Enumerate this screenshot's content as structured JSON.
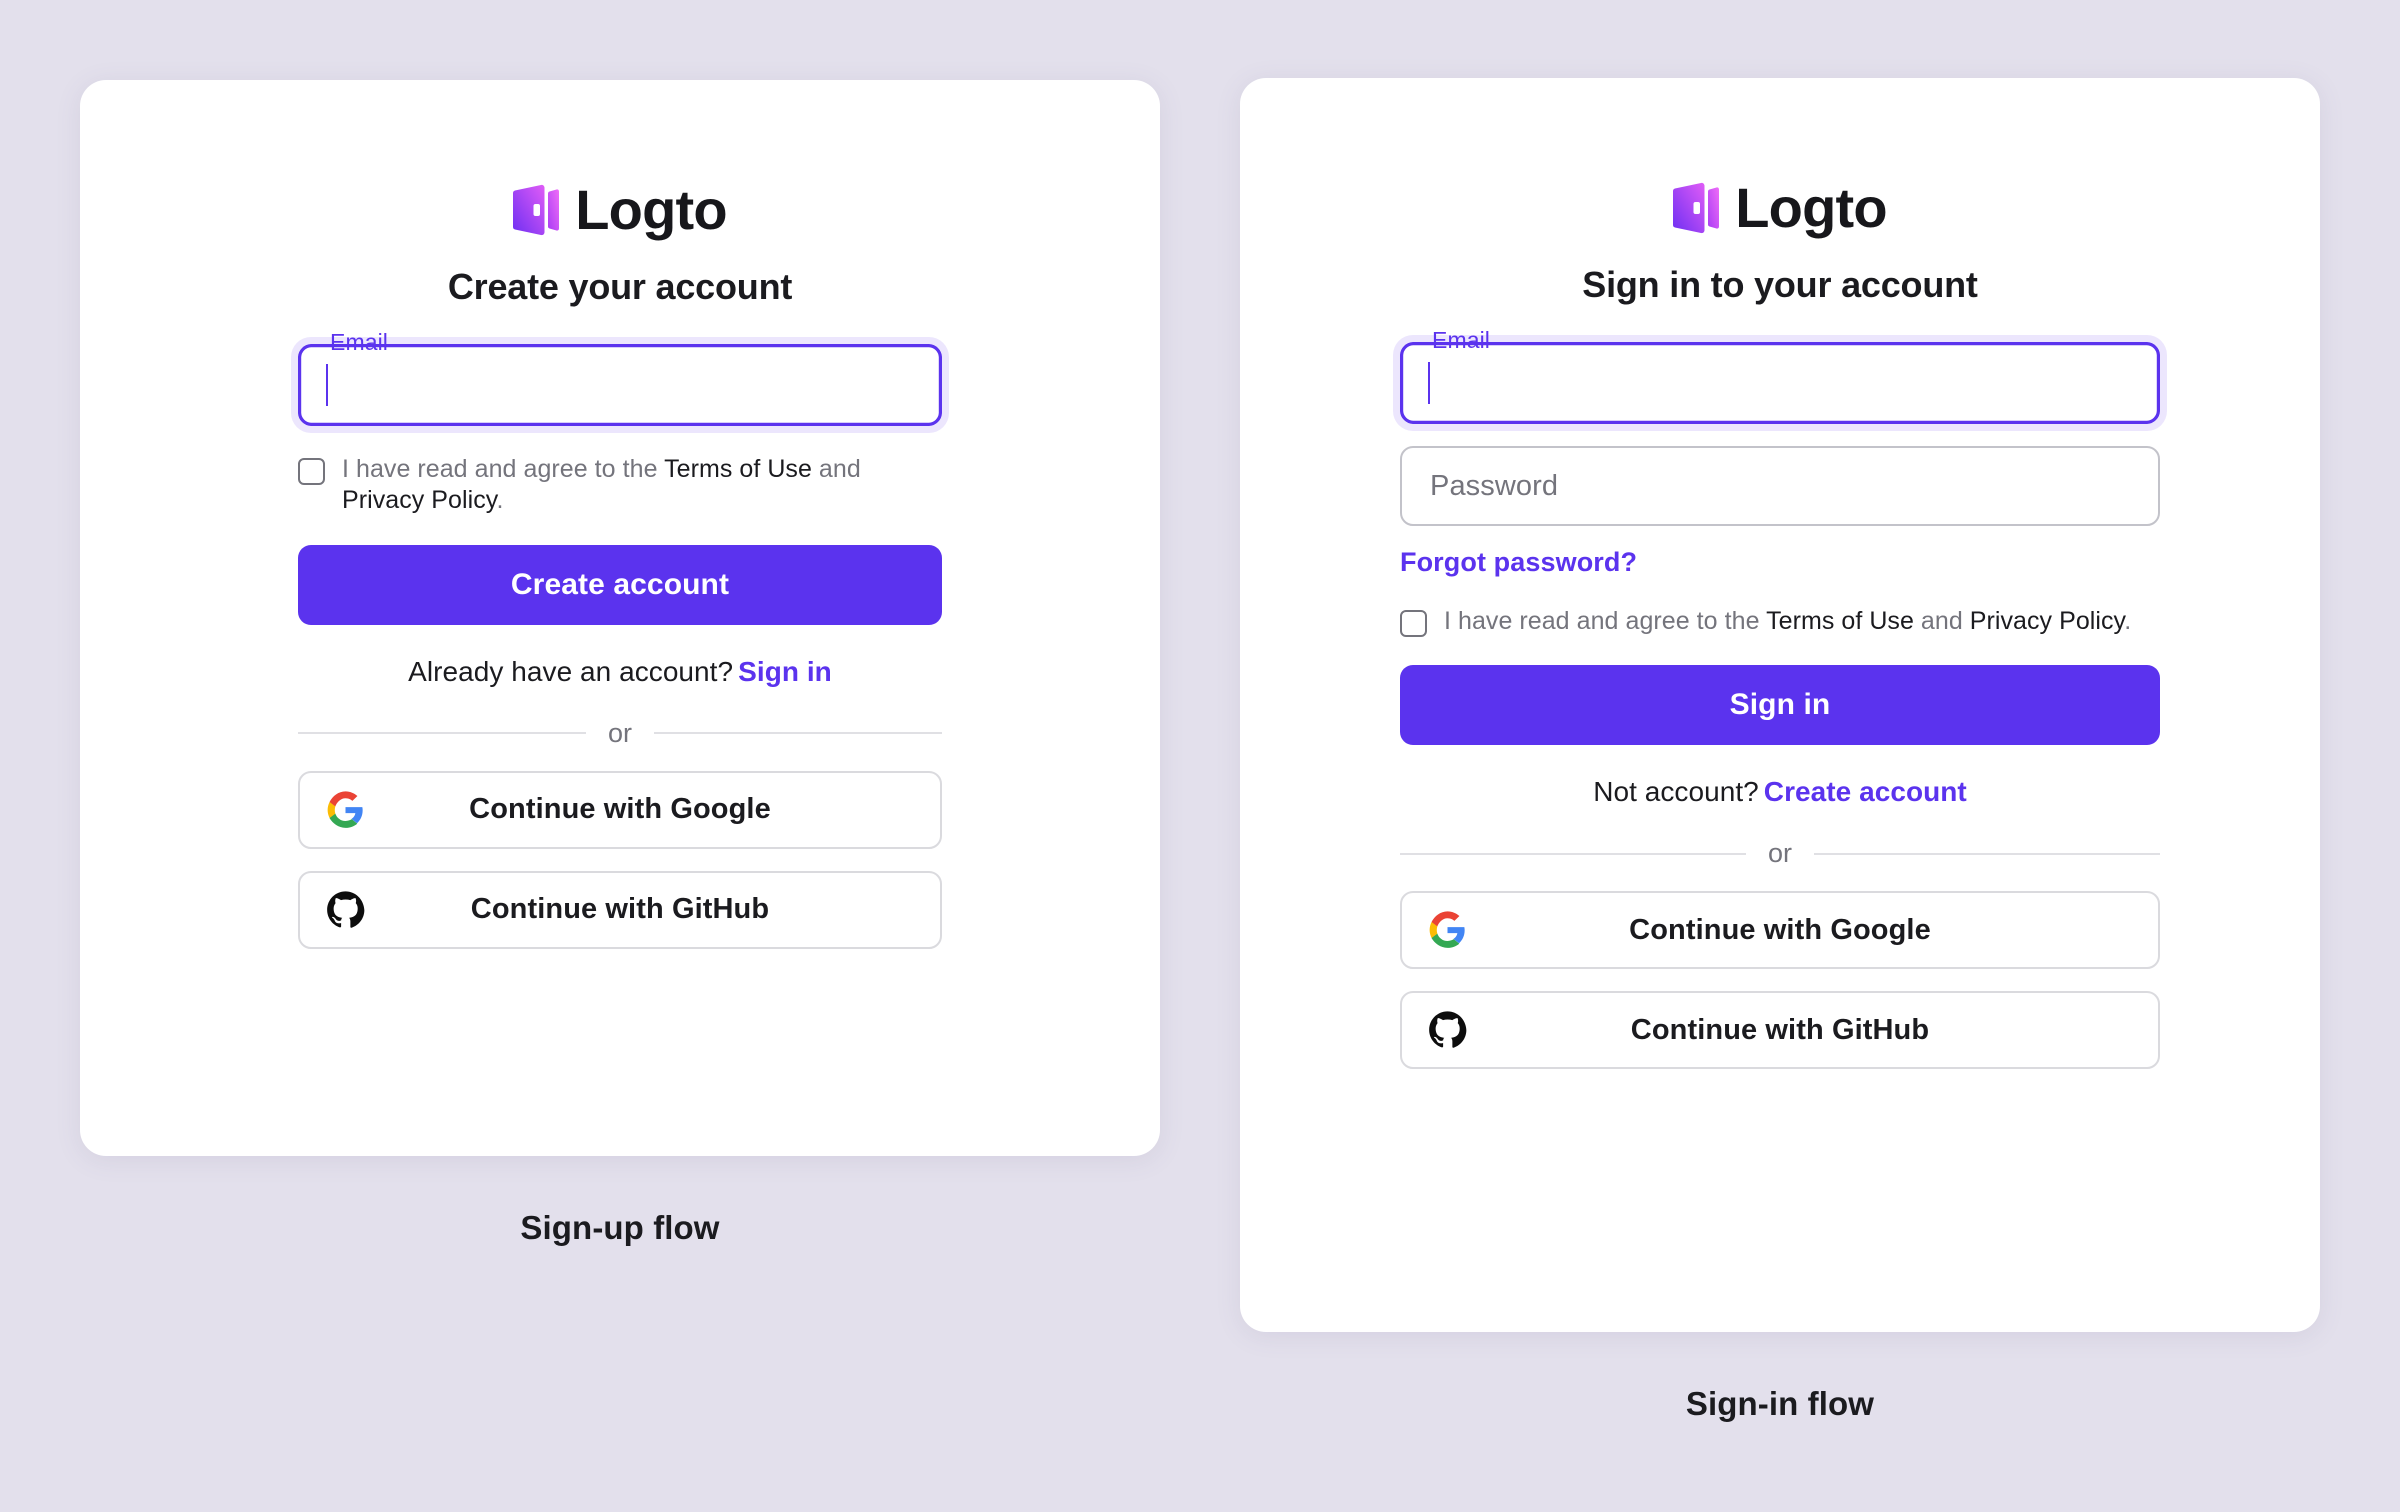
{
  "theme": {
    "background": "#e3e0ec",
    "card_background": "#ffffff",
    "accent": "#5b33ee",
    "text_primary": "#1b1b1f",
    "text_muted": "#74747c",
    "border": "#dadade"
  },
  "brand": {
    "name": "Logto",
    "logo_icon": "logto-door-logo",
    "logo_gradient_from": "#7a3cf0",
    "logo_gradient_to": "#e65cf5"
  },
  "signup": {
    "caption": "Sign-up flow",
    "headline": "Create your account",
    "email": {
      "label": "Email",
      "value": "",
      "placeholder": "",
      "focused": true
    },
    "terms": {
      "checkbox_icon": "checkbox-unchecked-icon",
      "checked": false,
      "prefix": "I have read and agree to the ",
      "terms_link": "Terms of Use",
      "conjunction": " and ",
      "privacy_link": "Privacy Policy",
      "suffix": "."
    },
    "submit_label": "Create account",
    "switch": {
      "question": "Already have an account?",
      "link": "Sign in"
    },
    "divider_label": "or",
    "social": [
      {
        "label": "Continue with Google",
        "icon": "google-icon"
      },
      {
        "label": "Continue with GitHub",
        "icon": "github-icon"
      }
    ]
  },
  "signin": {
    "caption": "Sign-in flow",
    "headline": "Sign in to your account",
    "email": {
      "label": "Email",
      "value": "",
      "placeholder": "",
      "focused": true
    },
    "password": {
      "label": "Password",
      "value": "",
      "placeholder": "Password",
      "focused": false
    },
    "forgot_label": "Forgot password?",
    "terms": {
      "checkbox_icon": "checkbox-unchecked-icon",
      "checked": false,
      "prefix": "I have read and agree to the ",
      "terms_link": "Terms of Use",
      "conjunction": " and ",
      "privacy_link": "Privacy Policy",
      "suffix": "."
    },
    "submit_label": "Sign in",
    "switch": {
      "question": "Not account?",
      "link": "Create account"
    },
    "divider_label": "or",
    "social": [
      {
        "label": "Continue with Google",
        "icon": "google-icon"
      },
      {
        "label": "Continue with GitHub",
        "icon": "github-icon"
      }
    ]
  }
}
